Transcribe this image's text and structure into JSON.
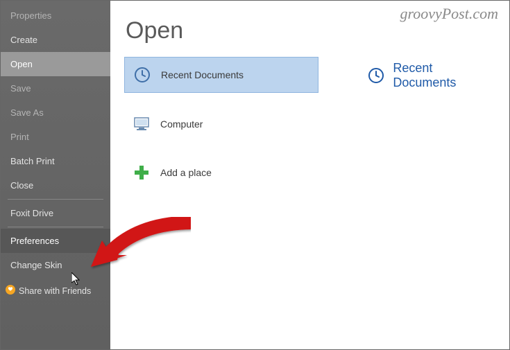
{
  "watermark": "groovyPost.com",
  "page_title": "Open",
  "sidebar": {
    "items": [
      {
        "label": "Properties",
        "faded": true
      },
      {
        "label": "Create"
      },
      {
        "label": "Open",
        "selected": true
      },
      {
        "label": "Save",
        "faded": true
      },
      {
        "label": "Save As",
        "faded": true
      },
      {
        "label": "Print",
        "faded": true
      },
      {
        "label": "Batch Print"
      },
      {
        "label": "Close"
      },
      {
        "label": "Foxit Drive"
      },
      {
        "label": "Preferences",
        "hover": true
      },
      {
        "label": "Change Skin"
      }
    ],
    "share_label": "Share with Friends"
  },
  "open_options": [
    {
      "label": "Recent Documents",
      "selected": true,
      "icon": "clock"
    },
    {
      "label": "Computer",
      "icon": "computer"
    },
    {
      "label": "Add a place",
      "icon": "plus"
    }
  ],
  "right_pane": {
    "title": "Recent Documents"
  }
}
